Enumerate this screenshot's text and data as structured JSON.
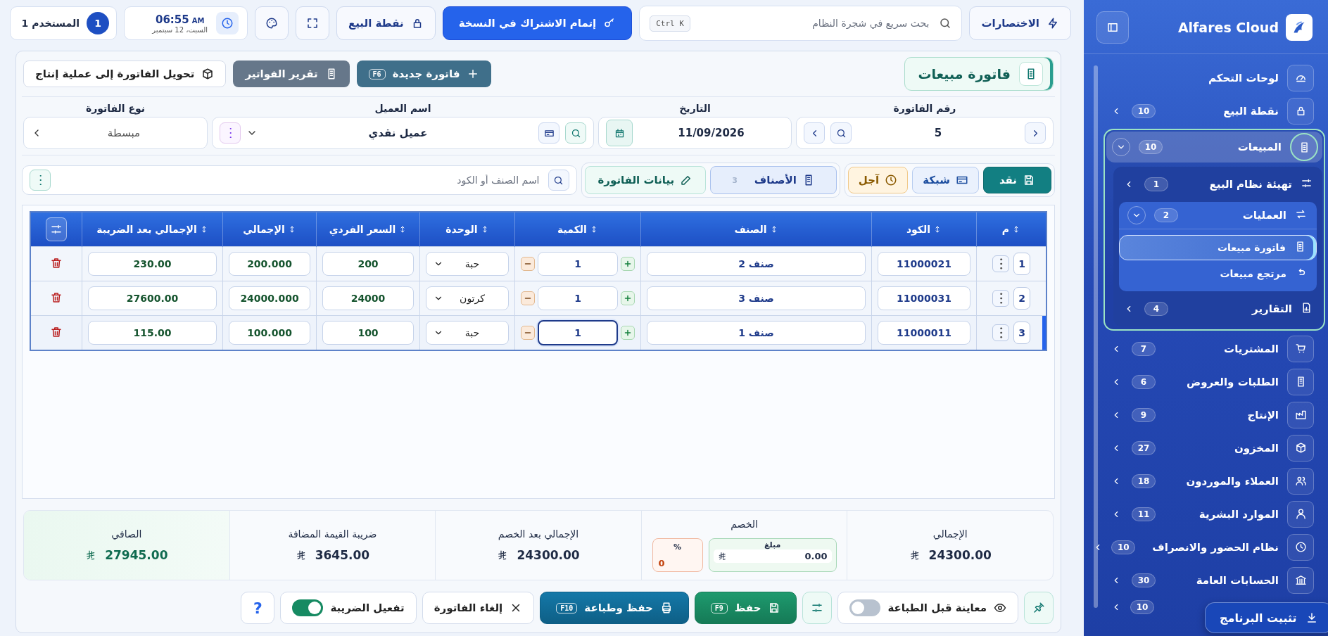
{
  "topbar": {
    "user": {
      "badge": "1",
      "label": "المستخدم 1"
    },
    "clock": {
      "time": "06:55",
      "ampm": "AM",
      "date": "السبت، 12 سبتمبر"
    },
    "pos_button": "نقطة البيع",
    "subscribe_button": "إتمام الاشتراك في النسخة",
    "search": {
      "placeholder": "بحث سريع في شجرة النظام",
      "shortcut": "Ctrl K"
    },
    "shortcuts_button": "الاختصارات"
  },
  "page": {
    "title": "فاتورة مبيعات",
    "actions": [
      {
        "kind": "primary",
        "label": "فاتورة جديدة",
        "key": "F6"
      },
      {
        "kind": "secondary",
        "label": "تقرير الفواتير"
      },
      {
        "kind": "outline",
        "label": "تحويل الفاتورة إلى عملية إنتاج"
      }
    ]
  },
  "fields": {
    "invoice_number": {
      "label": "رقم الفاتورة",
      "value": "5"
    },
    "date": {
      "label": "التاريخ",
      "value": "11/09/2026"
    },
    "customer": {
      "label": "اسم العميل",
      "value": "عميل نقدي"
    },
    "invoice_type": {
      "label": "نوع الفاتورة",
      "value": "مبسطة"
    }
  },
  "payment_tabs": [
    {
      "kind": "cash",
      "label": "نقد",
      "selected": true
    },
    {
      "kind": "network",
      "label": "شبكة",
      "selected": false
    },
    {
      "kind": "credit",
      "label": "آجل",
      "selected": false
    }
  ],
  "view_tabs": [
    {
      "label": "الأصناف",
      "count": "3",
      "selected": true
    },
    {
      "label": "بيانات الفاتورة",
      "selected": false
    }
  ],
  "item_search": {
    "placeholder": "اسم الصنف أو الكود"
  },
  "table": {
    "columns": [
      "م",
      "الكود",
      "الصنف",
      "الكمية",
      "الوحدة",
      "السعر الفردي",
      "الإجمالي",
      "الإجمالي بعد الضريبة"
    ],
    "rows": [
      {
        "index": "1",
        "code": "11000021",
        "item": "صنف 2",
        "qty": "1",
        "unit": "حبة",
        "price": "200",
        "total": "200.000",
        "total_tax": "230.00",
        "selected": false
      },
      {
        "index": "2",
        "code": "11000031",
        "item": "صنف 3",
        "qty": "1",
        "unit": "كرتون",
        "price": "24000",
        "total": "24000.000",
        "total_tax": "27600.00",
        "selected": false
      },
      {
        "index": "3",
        "code": "11000011",
        "item": "صنف 1",
        "qty": "1",
        "unit": "حبة",
        "price": "100",
        "total": "100.000",
        "total_tax": "115.00",
        "selected": true
      }
    ]
  },
  "summary": {
    "total": {
      "label": "الإجمالي",
      "value": "24300.00"
    },
    "discount": {
      "label": "الخصم",
      "amount_label": "مبلغ",
      "amount": "0.00",
      "percent_label": "%",
      "percent": "0"
    },
    "after_discount": {
      "label": "الإجمالي بعد الخصم",
      "value": "24300.00"
    },
    "vat": {
      "label": "ضريبة القيمة المضافة",
      "value": "3645.00"
    },
    "net": {
      "label": "الصافي",
      "value": "27945.00"
    }
  },
  "footer": {
    "print_preview": {
      "label": "معاينة قبل الطباعة",
      "on": false
    },
    "save": {
      "label": "حفظ",
      "key": "F9"
    },
    "save_print": {
      "label": "حفظ وطباعة",
      "key": "F10"
    },
    "cancel": "إلغاء الفاتورة",
    "tax_toggle": {
      "label": "تفعيل الضريبة",
      "on": true
    },
    "help": "?"
  },
  "sidebar": {
    "brand": "Alfares Cloud",
    "install_button": "تثبيت البرنامج",
    "items": [
      {
        "label": "لوحات التحكم"
      },
      {
        "label": "نقطة البيع",
        "badge": "10",
        "expanded": false
      },
      {
        "label": "المبيعات",
        "badge": "10",
        "expanded": true,
        "children": [
          {
            "label": "تهيئة نظام البيع",
            "badge": "1",
            "expanded": false
          },
          {
            "label": "العمليات",
            "badge": "2",
            "expanded": true,
            "children": [
              {
                "label": "فاتورة مبيعات",
                "selected": true
              },
              {
                "label": "مرتجع مبيعات",
                "selected": false
              }
            ]
          },
          {
            "label": "التقارير",
            "badge": "4",
            "expanded": false
          }
        ]
      },
      {
        "label": "المشتريات",
        "badge": "7",
        "expanded": false
      },
      {
        "label": "الطلبات والعروض",
        "badge": "6",
        "expanded": false
      },
      {
        "label": "الإنتاج",
        "badge": "9",
        "expanded": false
      },
      {
        "label": "المخزون",
        "badge": "27",
        "expanded": false
      },
      {
        "label": "العملاء والموردون",
        "badge": "18",
        "expanded": false
      },
      {
        "label": "الموارد البشرية",
        "badge": "11",
        "expanded": false
      },
      {
        "label": "نظام الحضور والانصراف",
        "badge": "10",
        "expanded": false
      },
      {
        "label": "الحسابات العامة",
        "badge": "30",
        "expanded": false
      },
      {
        "badge": "10",
        "expanded": false
      }
    ]
  }
}
